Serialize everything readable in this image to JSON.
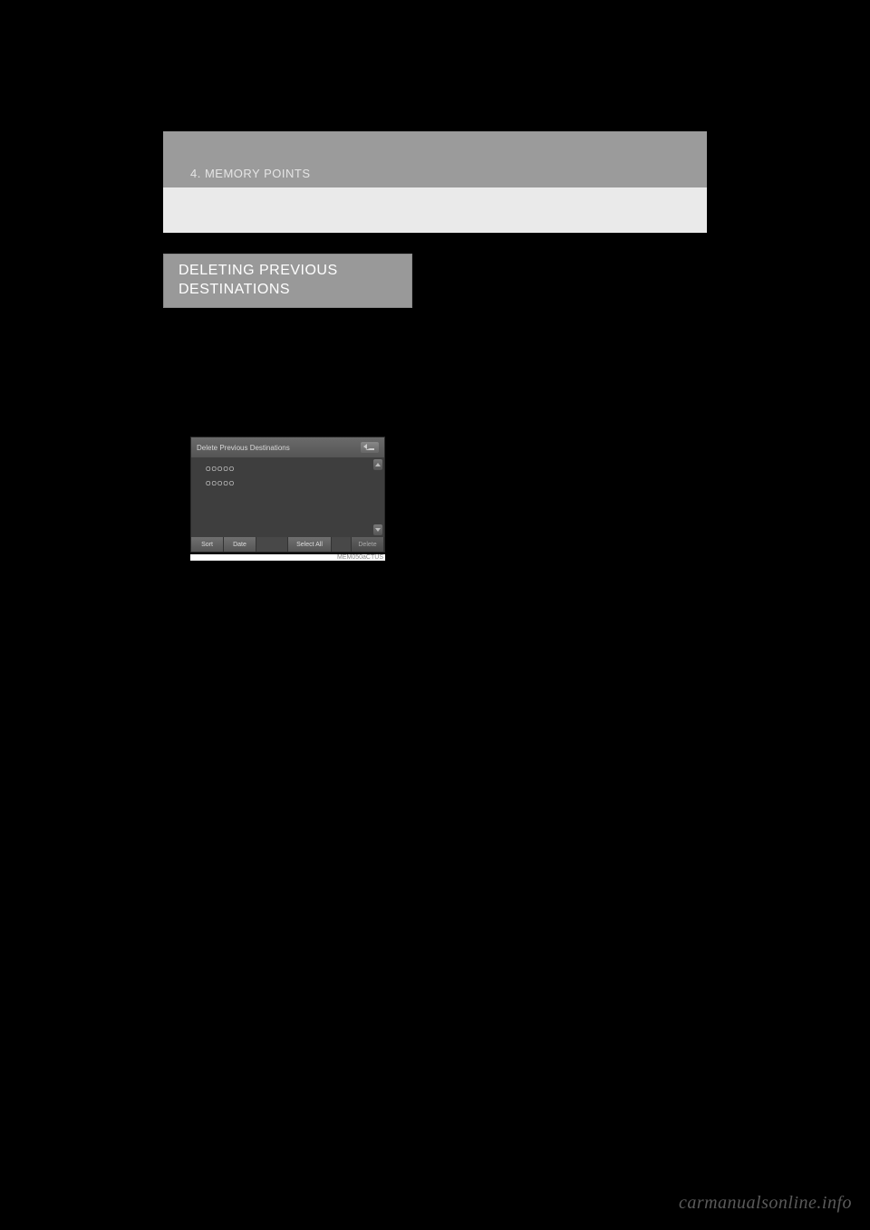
{
  "header": {
    "breadcrumb": "4. MEMORY POINTS"
  },
  "section": {
    "title_line1": "DELETING PREVIOUS",
    "title_line2": "DESTINATIONS"
  },
  "nav_screenshot": {
    "title": "Delete Previous Destinations",
    "rows": [
      "OOOOO",
      "OOOOO"
    ],
    "scroll_up": "▲",
    "scroll_down": "▼",
    "footer": {
      "sort": "Sort",
      "date": "Date",
      "select_all": "Select All",
      "delete": "Delete"
    },
    "image_code": "MEM050aCTUS"
  },
  "watermark": "carmanualsonline.info"
}
